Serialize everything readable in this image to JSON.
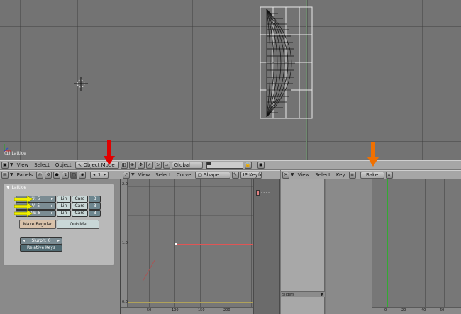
{
  "viewport": {
    "object_label": "(1) Lattice",
    "menus": [
      "View",
      "Select",
      "Object"
    ],
    "mode": "Object Mode",
    "orientation": "Global"
  },
  "buttons_window": {
    "panels_label": "Panels",
    "page_value": "1",
    "panel_title": "Lattice",
    "rows": [
      {
        "field": "U: 5",
        "interp": "Lin",
        "type": "Card",
        "b": "B"
      },
      {
        "field": "V: 5",
        "interp": "Lin",
        "type": "Card",
        "b": "B"
      },
      {
        "field": "W: 5",
        "interp": "Lin",
        "type": "Card",
        "b": "B"
      }
    ],
    "make_regular": "Make Regular",
    "outside": "Outside",
    "slurph": "Slurph: 0",
    "relative_keys": "Relative Keys"
  },
  "ipo_window": {
    "menus": [
      "View",
      "Select",
      "Curve"
    ],
    "shape": "Shape",
    "ipo_field": "IP:Keyfr",
    "y_ticks": [
      "2.0",
      "1.0",
      "0.0"
    ],
    "x_ticks": [
      "50",
      "100",
      "150",
      "200"
    ],
    "key_label": "- - - -"
  },
  "action_window": {
    "menus": [
      "View",
      "Select",
      "Key"
    ],
    "bake": "Bake",
    "sliders": "Sliders",
    "x_ticks": [
      "0",
      "20",
      "40",
      "60"
    ]
  },
  "colors": {
    "arrow_red": "#e00000",
    "arrow_orange": "#f07000",
    "yellow_arrows": "#f0f000",
    "frame_line": "#33aa33"
  }
}
